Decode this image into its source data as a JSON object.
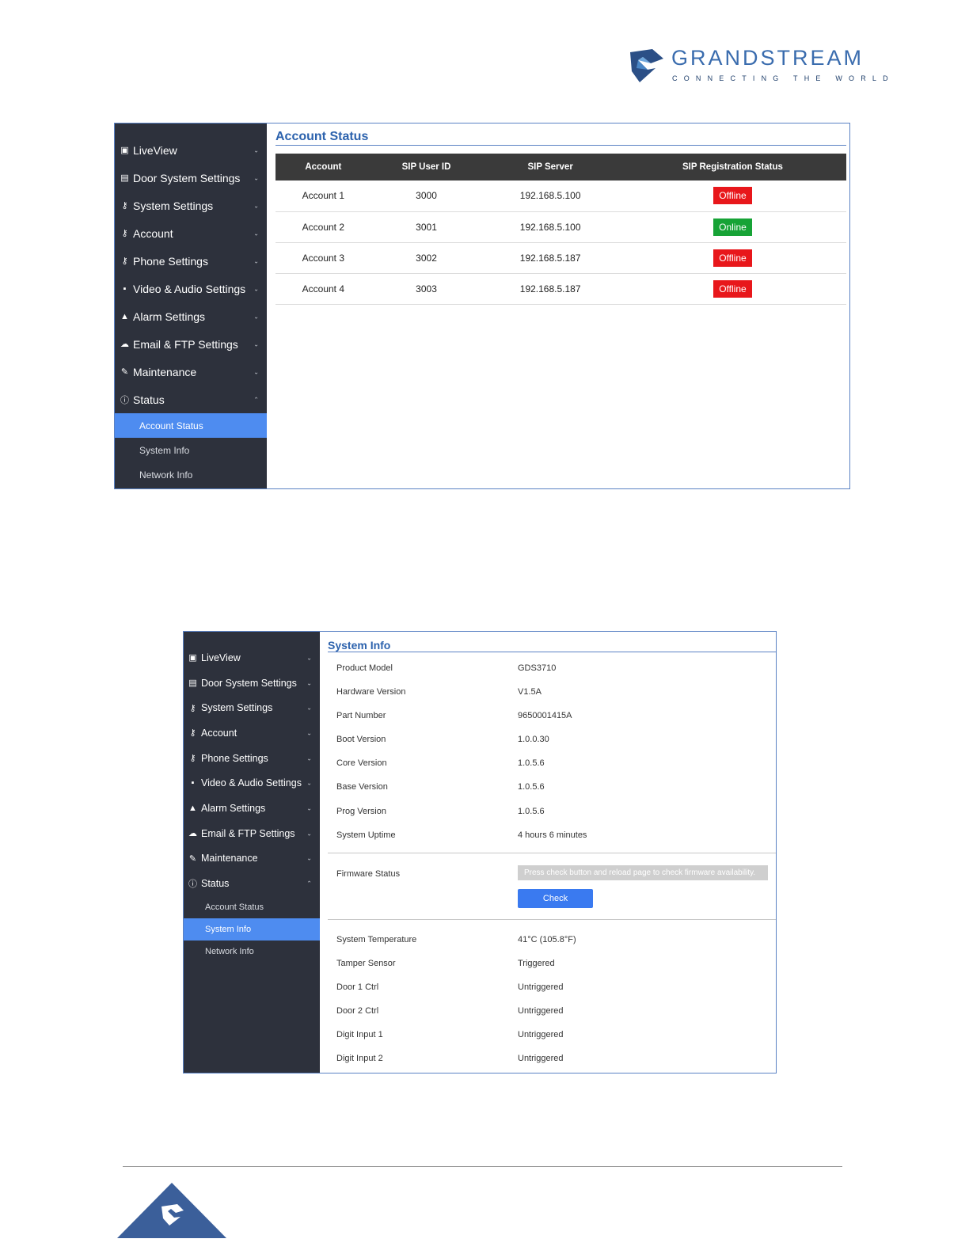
{
  "brand": {
    "name": "GRANDSTREAM",
    "tagline": "CONNECTING THE WORLD"
  },
  "panel1": {
    "sidebar": {
      "items": [
        {
          "label": "LiveView",
          "icon": "video-icon"
        },
        {
          "label": "Door System Settings",
          "icon": "card-icon"
        },
        {
          "label": "System Settings",
          "icon": "key-icon"
        },
        {
          "label": "Account",
          "icon": "key-icon"
        },
        {
          "label": "Phone Settings",
          "icon": "key-icon"
        },
        {
          "label": "Video & Audio Settings",
          "icon": "camera-mic-icon"
        },
        {
          "label": "Alarm Settings",
          "icon": "bell-icon"
        },
        {
          "label": "Email & FTP Settings",
          "icon": "cloud-icon"
        },
        {
          "label": "Maintenance",
          "icon": "wrench-icon"
        },
        {
          "label": "Status",
          "icon": "info-icon"
        }
      ],
      "subitems": [
        "Account Status",
        "System Info",
        "Network Info"
      ]
    },
    "title": "Account Status",
    "columns": [
      "Account",
      "SIP User ID",
      "SIP Server",
      "SIP Registration Status"
    ],
    "rows": [
      {
        "account": "Account 1",
        "user_id": "3000",
        "server": "192.168.5.100",
        "status": "Offline"
      },
      {
        "account": "Account 2",
        "user_id": "3001",
        "server": "192.168.5.100",
        "status": "Online"
      },
      {
        "account": "Account 3",
        "user_id": "3002",
        "server": "192.168.5.187",
        "status": "Offline"
      },
      {
        "account": "Account 4",
        "user_id": "3003",
        "server": "192.168.5.187",
        "status": "Offline"
      }
    ],
    "colors": {
      "offline": "#e8171b",
      "online": "#17a336",
      "active_nav": "#4e8cf0"
    }
  },
  "panel2": {
    "sidebar": {
      "items": [
        {
          "label": "LiveView"
        },
        {
          "label": "Door System Settings"
        },
        {
          "label": "System Settings"
        },
        {
          "label": "Account"
        },
        {
          "label": "Phone Settings"
        },
        {
          "label": "Video & Audio Settings"
        },
        {
          "label": "Alarm Settings"
        },
        {
          "label": "Email & FTP Settings"
        },
        {
          "label": "Maintenance"
        },
        {
          "label": "Status"
        }
      ],
      "subitems": [
        "Account Status",
        "System Info",
        "Network Info"
      ]
    },
    "title": "System Info",
    "info": [
      {
        "label": "Product Model",
        "value": "GDS3710"
      },
      {
        "label": "Hardware Version",
        "value": "V1.5A"
      },
      {
        "label": "Part Number",
        "value": "9650001415A"
      },
      {
        "label": "Boot Version",
        "value": "1.0.0.30"
      },
      {
        "label": "Core Version",
        "value": "1.0.5.6"
      },
      {
        "label": "Base Version",
        "value": "1.0.5.6"
      },
      {
        "label": "Prog Version",
        "value": "1.0.5.6"
      },
      {
        "label": "System Uptime",
        "value": "4 hours 6 minutes"
      }
    ],
    "firmware": {
      "label": "Firmware Status",
      "note": "Press check button and reload page to check firmware availability.",
      "button": "Check"
    },
    "sensors": [
      {
        "label": "System Temperature",
        "value": "41°C (105.8°F)"
      },
      {
        "label": "Tamper Sensor",
        "value": "Triggered"
      },
      {
        "label": "Door 1 Ctrl",
        "value": "Untriggered"
      },
      {
        "label": "Door 2 Ctrl",
        "value": "Untriggered"
      },
      {
        "label": "Digit Input 1",
        "value": "Untriggered"
      },
      {
        "label": "Digit Input 2",
        "value": "Untriggered"
      }
    ]
  }
}
